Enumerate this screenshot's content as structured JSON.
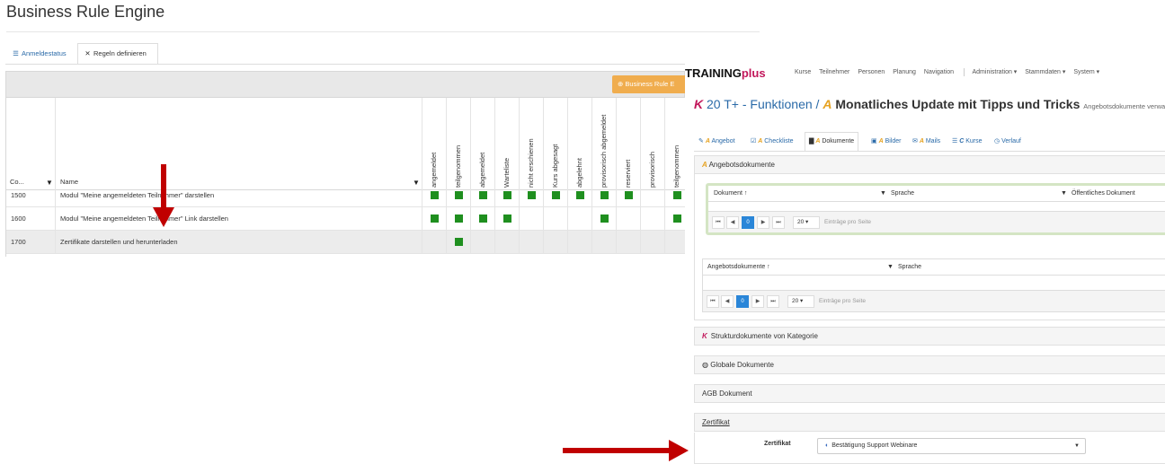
{
  "bre": {
    "title": "Business Rule Engine",
    "tabs": [
      {
        "label": "Anmeldestatus",
        "icon": "list-icon"
      },
      {
        "label": "Regeln definieren",
        "icon": "tools-icon"
      }
    ],
    "add_button_label": "Business Rule E",
    "columns": {
      "code": "Co...",
      "name": "Name",
      "statuses": [
        "angemeldet",
        "teilgenommen",
        "abgemeldet",
        "Warteliste",
        "nicht erschienen",
        "Kurs abgesagt",
        "abgelehnt",
        "provisorisch abgemeldet",
        "reserviert",
        "provisorisch",
        "teilgenommen"
      ]
    },
    "rows": [
      {
        "code": "1500",
        "name": "Modul \"Meine angemeldeten Teilnehmer\" darstellen",
        "marks": [
          1,
          1,
          1,
          1,
          1,
          1,
          1,
          1,
          1,
          0,
          1
        ]
      },
      {
        "code": "1600",
        "name": "Modul \"Meine angemeldeten Teilnehmer\" Link darstellen",
        "marks": [
          1,
          1,
          1,
          1,
          0,
          0,
          0,
          1,
          0,
          0,
          1
        ]
      },
      {
        "code": "1700",
        "name": "Zertifikate darstellen und herunterladen",
        "marks": [
          0,
          1,
          0,
          0,
          0,
          0,
          0,
          0,
          0,
          0,
          0
        ]
      }
    ],
    "colors": {
      "mark": "#1f8f1f",
      "add_button": "#f0ad4e",
      "arrow": "#c00000"
    }
  },
  "tp": {
    "brand_main": "TRAINING",
    "brand_plus": "plus",
    "nav": [
      "Kurse",
      "Teilnehmer",
      "Personen",
      "Planung",
      "Navigation"
    ],
    "nav_menus": [
      "Administration ▾",
      "Stammdaten ▾",
      "System ▾"
    ],
    "heading": {
      "k": "K",
      "course_num": "20 T+ - Funktionen /",
      "a": "A",
      "offer": "Monatliches Update mit Tipps und Tricks",
      "sub": "Angebotsdokumente verwalten"
    },
    "tabs": [
      {
        "icon": "pencil-icon",
        "prefix": "A",
        "label": "Angebot"
      },
      {
        "icon": "checklist-icon",
        "prefix": "A",
        "label": "Checkliste"
      },
      {
        "icon": "document-icon",
        "prefix": "A",
        "label": "Dokumente"
      },
      {
        "icon": "image-icon",
        "prefix": "A",
        "label": "Bilder"
      },
      {
        "icon": "mail-icon",
        "prefix": "A",
        "label": "Mails"
      },
      {
        "icon": "list-icon",
        "prefix": "C",
        "label": "Kurse"
      },
      {
        "icon": "history-icon",
        "prefix": "",
        "label": "Verlauf"
      }
    ],
    "angebotsdokumente": {
      "prefix": "A",
      "title": "Angebotsdokumente",
      "grid1": {
        "cols": [
          "Dokument ↑",
          "Sprache",
          "Öffentliches Dokument"
        ]
      },
      "grid2": {
        "cols": [
          "Angebotsdokumente ↑",
          "Sprache"
        ]
      },
      "pager": {
        "page": "0",
        "size": "20 ▾",
        "label": "Einträge pro Seite"
      }
    },
    "struktur": {
      "prefix": "K",
      "title": "Strukturdokumente von Kategorie"
    },
    "globale": {
      "title": "Globale Dokumente"
    },
    "agb": {
      "title": "AGB Dokument"
    },
    "zertifikat": {
      "title": "Zertifikat",
      "label": "Zertifikat",
      "value": "Bestätigung Support Webinare"
    }
  }
}
